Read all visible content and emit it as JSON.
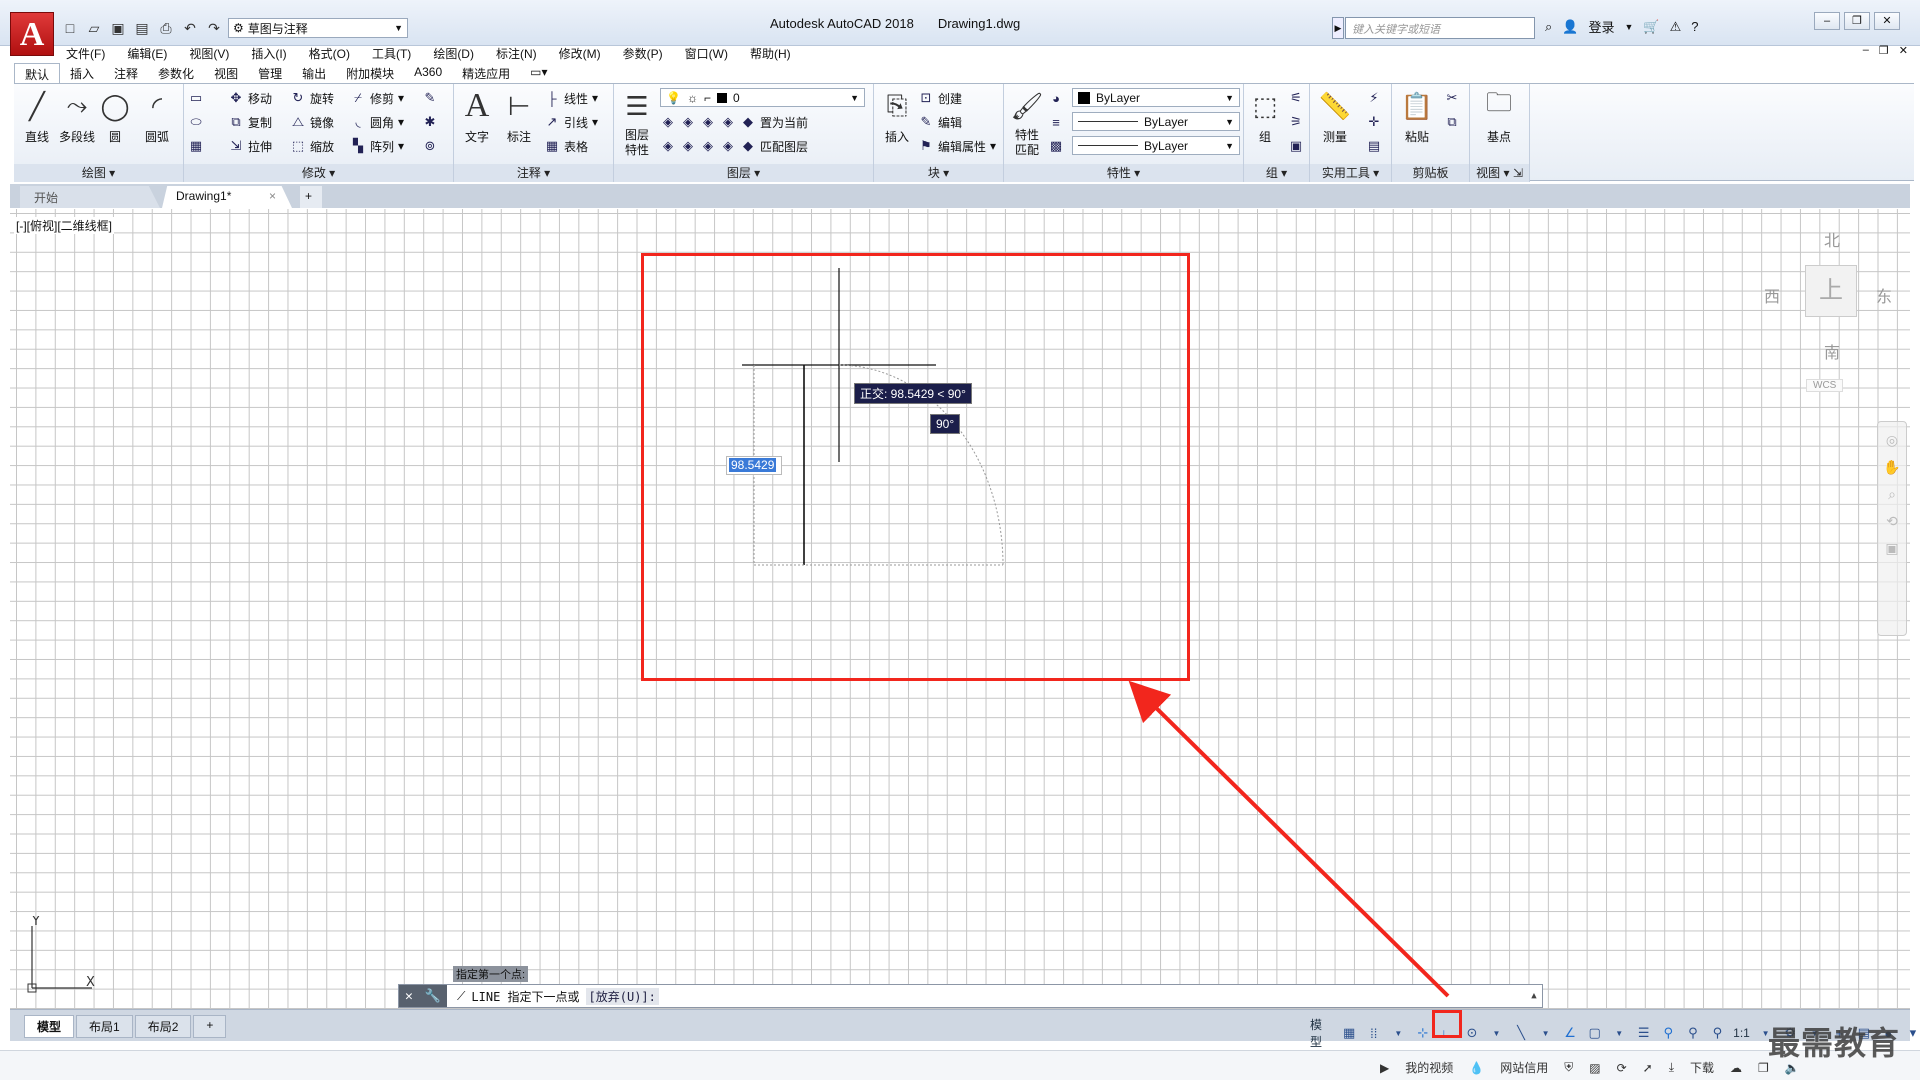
{
  "app": {
    "logo_letter": "A",
    "title": "Autodesk AutoCAD 2018",
    "document": "Drawing1.dwg",
    "workspace": "草图与注释",
    "search_placeholder": "键入关键字或短语",
    "login_label": "登录"
  },
  "menu": [
    "文件(F)",
    "编辑(E)",
    "视图(V)",
    "插入(I)",
    "格式(O)",
    "工具(T)",
    "绘图(D)",
    "标注(N)",
    "修改(M)",
    "参数(P)",
    "窗口(W)",
    "帮助(H)"
  ],
  "ribbon_tabs": [
    "默认",
    "插入",
    "注释",
    "参数化",
    "视图",
    "管理",
    "输出",
    "附加模块",
    "A360",
    "精选应用"
  ],
  "ribbon": {
    "draw": {
      "title": "绘图",
      "line": "直线",
      "polyline": "多段线",
      "circle": "圆",
      "arc": "圆弧"
    },
    "modify": {
      "title": "修改",
      "move": "移动",
      "rotate": "旋转",
      "trim": "修剪",
      "copy": "复制",
      "mirror": "镜像",
      "fillet": "圆角",
      "stretch": "拉伸",
      "scale": "缩放",
      "array": "阵列"
    },
    "annotation": {
      "title": "注释",
      "text": "文字",
      "dimension": "标注",
      "linear": "线性",
      "leader": "引线",
      "table": "表格"
    },
    "layers": {
      "title": "图层",
      "properties": "图层\n特性",
      "layer_value": "0",
      "set_current": "置为当前",
      "match_layer": "匹配图层"
    },
    "block": {
      "title": "块",
      "insert": "插入",
      "create": "创建",
      "edit": "编辑",
      "edit_attr": "编辑属性"
    },
    "properties": {
      "title": "特性",
      "match": "特性\n匹配",
      "color": "ByLayer",
      "linetype": "ByLayer",
      "lineweight": "ByLayer"
    },
    "group": {
      "title": "组",
      "group": "组"
    },
    "utilities": {
      "title": "实用工具",
      "measure": "测量"
    },
    "clipboard": {
      "title": "剪贴板",
      "paste": "粘贴"
    },
    "view": {
      "title": "视图",
      "base": "基点"
    }
  },
  "file_tabs": {
    "start": "开始",
    "drawing": "Drawing1*",
    "close": "×",
    "add": "+"
  },
  "viewport_label": "[-][俯视][二维线框]",
  "viewcube": {
    "north": "北",
    "south": "南",
    "east": "东",
    "west": "西",
    "face": "上",
    "wcs": "WCS"
  },
  "dynamic": {
    "polar_tooltip": "正交: 98.5429 < 90°",
    "angle": "90°",
    "length_input": "98.5429"
  },
  "command": {
    "hint": "指定第一个点:",
    "prompt": "LINE 指定下一点或",
    "option": "[放弃(U)]:"
  },
  "layout_tabs": [
    "模型",
    "布局1",
    "布局2"
  ],
  "status": {
    "model": "模型",
    "scale": "1:1"
  },
  "os_strip": [
    "我的视频",
    "网站信用",
    "下载"
  ],
  "watermark": "最需教育",
  "colors": {
    "highlight": "#f2261d",
    "tooltip_bg": "#1b1e4a"
  }
}
